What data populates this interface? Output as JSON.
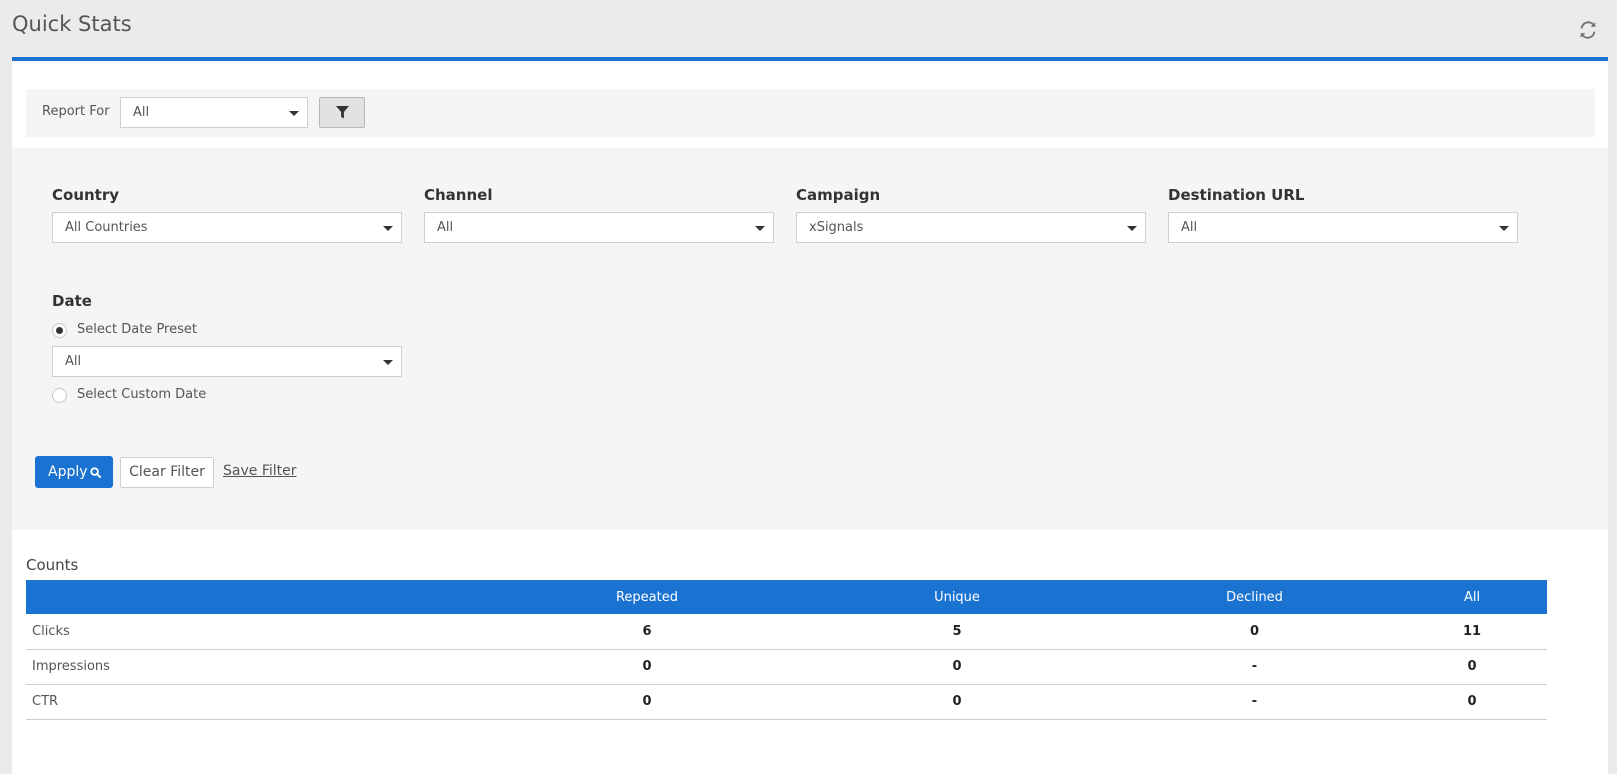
{
  "header": {
    "title": "Quick Stats",
    "refresh_icon": "refresh-icon"
  },
  "report_for": {
    "label": "Report For",
    "value": "All",
    "filter_icon": "filter-icon"
  },
  "filters": {
    "country": {
      "label": "Country",
      "value": "All Countries"
    },
    "channel": {
      "label": "Channel",
      "value": "All"
    },
    "campaign": {
      "label": "Campaign",
      "value": "xSignals"
    },
    "destination": {
      "label": "Destination URL",
      "value": "All"
    },
    "date": {
      "label": "Date",
      "preset_label": "Select Date Preset",
      "preset_selected": true,
      "preset_value": "All",
      "custom_label": "Select Custom Date",
      "custom_selected": false
    }
  },
  "actions": {
    "apply": "Apply",
    "clear": "Clear Filter",
    "save": "Save Filter"
  },
  "counts": {
    "title": "Counts",
    "columns": [
      "",
      "Repeated",
      "Unique",
      "Declined",
      "All"
    ],
    "rows": [
      {
        "label": "Clicks",
        "repeated": "6",
        "unique": "5",
        "declined": "0",
        "all": "11"
      },
      {
        "label": "Impressions",
        "repeated": "0",
        "unique": "0",
        "declined": "-",
        "all": "0"
      },
      {
        "label": "CTR",
        "repeated": "0",
        "unique": "0",
        "declined": "-",
        "all": "0"
      }
    ]
  },
  "colors": {
    "accent": "#1a73d0",
    "header_bg": "#ebebeb",
    "filter_bg": "#f5f5f7"
  }
}
